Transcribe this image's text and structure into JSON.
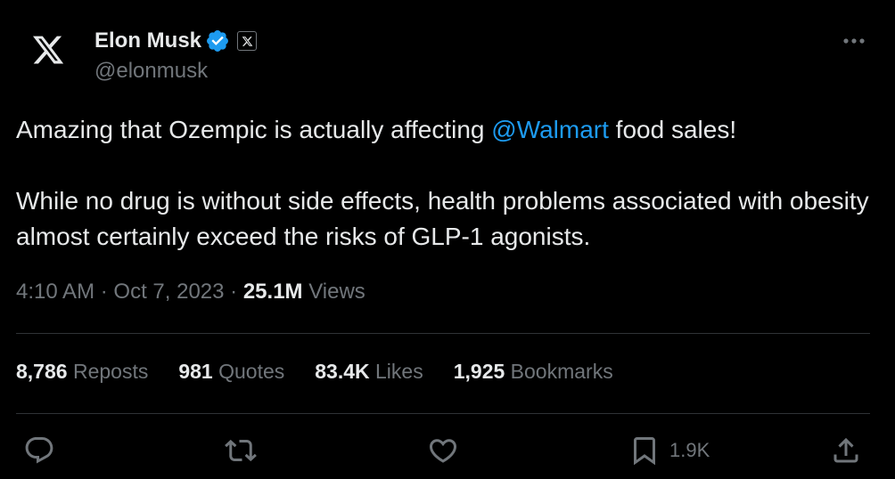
{
  "author": {
    "name": "Elon Musk",
    "handle": "@elonmusk"
  },
  "tweet": {
    "line1_before": "Amazing that Ozempic is actually affecting ",
    "mention": "@Walmart",
    "line1_after": " food sales!",
    "paragraph2": "While no drug is without side effects, health problems associated with obesity almost certainly exceed the risks of GLP-1 agonists."
  },
  "meta": {
    "time": "4:10 AM",
    "date": "Oct 7, 2023",
    "views_count": "25.1M",
    "views_label": "Views",
    "separator": "·"
  },
  "stats": {
    "reposts": {
      "count": "8,786",
      "label": "Reposts"
    },
    "quotes": {
      "count": "981",
      "label": "Quotes"
    },
    "likes": {
      "count": "83.4K",
      "label": "Likes"
    },
    "bookmarks": {
      "count": "1,925",
      "label": "Bookmarks"
    }
  },
  "actions": {
    "bookmark_count": "1.9K"
  },
  "icons": [
    "x-logo-icon",
    "verified-badge-icon",
    "x-affiliate-icon",
    "more-icon",
    "reply-icon",
    "repost-icon",
    "like-icon",
    "bookmark-icon",
    "share-icon"
  ],
  "colors": {
    "background": "#000000",
    "text": "#e7e9ea",
    "secondary": "#71767b",
    "accent": "#1d9bf0",
    "divider": "#2f3336"
  }
}
